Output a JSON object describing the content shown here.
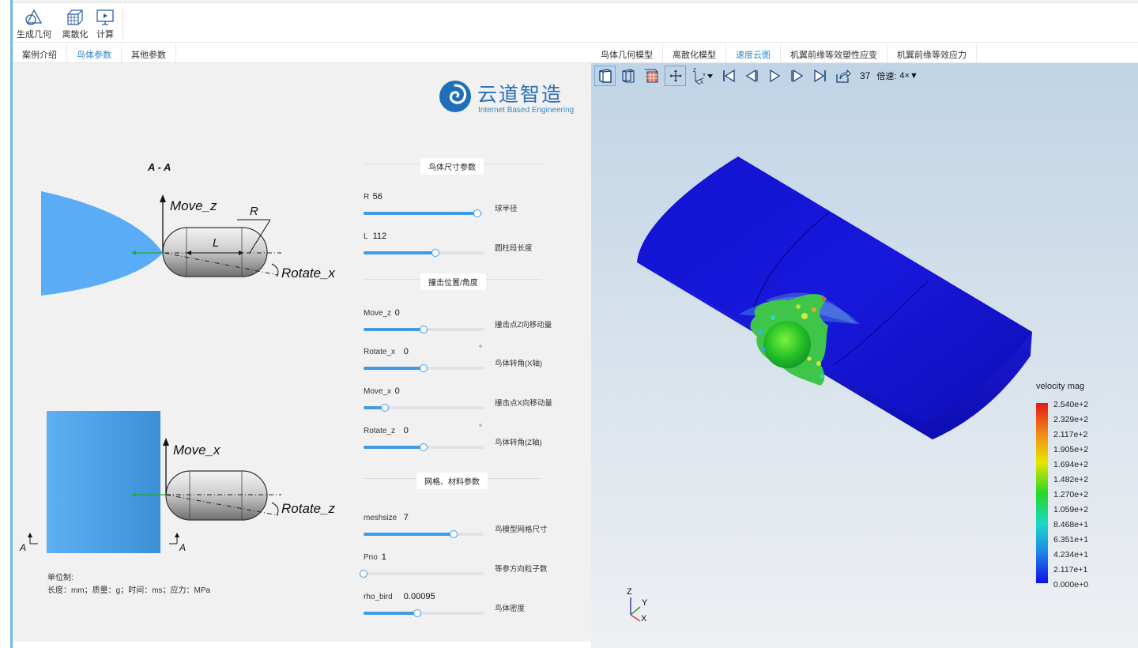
{
  "toolbar": {
    "items": [
      {
        "label": "生成几何",
        "icon": "geometry-icon"
      },
      {
        "label": "离散化",
        "icon": "mesh-icon"
      },
      {
        "label": "计算",
        "icon": "compute-icon"
      }
    ]
  },
  "left_tabs": [
    {
      "label": "案例介绍",
      "active": false
    },
    {
      "label": "鸟体参数",
      "active": true
    },
    {
      "label": "其他参数",
      "active": false
    }
  ],
  "right_tabs": [
    {
      "label": "鸟体几何模型",
      "active": false
    },
    {
      "label": "离散化模型",
      "active": false
    },
    {
      "label": "速度云图",
      "active": true
    },
    {
      "label": "机翼前缘等效塑性应变",
      "active": false
    },
    {
      "label": "机翼前缘等效应力",
      "active": false
    }
  ],
  "logo": {
    "name": "云道智造",
    "tagline": "Internet Based Engineering"
  },
  "diagram": {
    "section_label": "A - A",
    "move_z": "Move_z",
    "radius": "R",
    "length": "L",
    "rotate_x": "Rotate_x",
    "move_x": "Move_x",
    "rotate_z": "Rotate_z",
    "section_a1": "A",
    "section_a2": "A"
  },
  "sections": [
    {
      "title": "鸟体尺寸参数"
    },
    {
      "title": "撞击位置/角度"
    },
    {
      "title": "网格、材料参数"
    }
  ],
  "params": [
    {
      "name": "R",
      "value": "56",
      "unit": "",
      "desc": "球半径",
      "fraction": 0.95
    },
    {
      "name": "L",
      "value": "112",
      "unit": "",
      "desc": "圆柱段长度",
      "fraction": 0.6
    },
    {
      "name": "Move_z",
      "value": "0",
      "unit": "",
      "desc": "撞击点Z向移动量",
      "fraction": 0.5
    },
    {
      "name": "Rotate_x",
      "value": "0",
      "unit": "°",
      "desc": "鸟体转角(X轴)",
      "fraction": 0.5
    },
    {
      "name": "Move_x",
      "value": "0",
      "unit": "",
      "desc": "撞击点X向移动量",
      "fraction": 0.18
    },
    {
      "name": "Rotate_z",
      "value": "0",
      "unit": "°",
      "desc": "鸟体转角(Z轴)",
      "fraction": 0.5
    },
    {
      "name": "meshsize",
      "value": "7",
      "unit": "",
      "desc": "鸟模型网格尺寸",
      "fraction": 0.75
    },
    {
      "name": "Pno",
      "value": "1",
      "unit": "",
      "desc": "等参方向粒子数",
      "fraction": 0.0
    },
    {
      "name": "rho_bird",
      "value": "0.00095",
      "unit": "",
      "desc": "鸟体密度",
      "fraction": 0.45
    }
  ],
  "units": {
    "title": "单位制:",
    "line": "长度：mm；质量：g；时间：ms；应力：MPa"
  },
  "viewer": {
    "frame": "37",
    "speed_label": "倍速:",
    "speed_value": "4×▼"
  },
  "legend": {
    "title": "velocity mag",
    "labels": [
      "2.540e+2",
      "2.329e+2",
      "2.117e+2",
      "1.905e+2",
      "1.694e+2",
      "1.482e+2",
      "1.270e+2",
      "1.059e+2",
      "8.468e+1",
      "6.351e+1",
      "4.234e+1",
      "2.117e+1",
      "0.000e+0"
    ]
  },
  "axes": {
    "z": "Z",
    "y": "Y",
    "x": "X"
  },
  "colors": {
    "accent": "#2a8ac6",
    "slider": "#3f9be3",
    "wing": "#1010d8"
  }
}
